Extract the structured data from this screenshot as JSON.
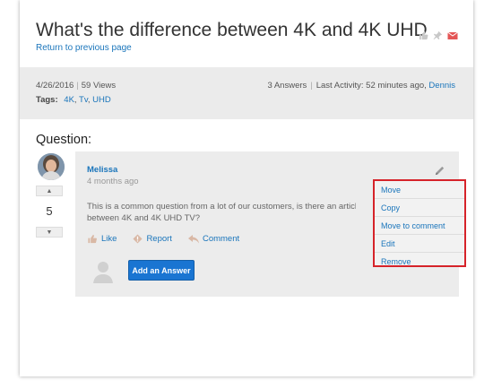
{
  "header": {
    "title": "What's the difference between 4K and 4K UHD",
    "return_link": "Return to previous page",
    "icons": [
      "thumbs-up-icon",
      "pin-icon",
      "email-icon"
    ]
  },
  "meta": {
    "date": "4/26/2016",
    "views": "59 Views",
    "tags_label": "Tags:",
    "tags": [
      "4K",
      "Tv",
      "UHD"
    ],
    "answers": "3 Answers",
    "last_activity": "Last Activity: 52 minutes ago,",
    "last_activity_user": "Dennis"
  },
  "question": {
    "heading": "Question:",
    "vote_count": "5",
    "author": "Melissa",
    "time_ago": "4 months ago",
    "body_line1": "This is a common question from a lot of our customers, is there an article tha",
    "body_line2": "between 4K and 4K UHD TV?",
    "actions": {
      "like": "Like",
      "report": "Report",
      "comment": "Comment"
    },
    "add_answer_label": "Add an Answer"
  },
  "context_menu": {
    "items": [
      "Move",
      "Copy",
      "Move to comment",
      "Edit",
      "Remove"
    ]
  },
  "colors": {
    "link": "#1a75bb",
    "highlight_border": "#d6232a",
    "primary_button": "#1a75d2"
  }
}
